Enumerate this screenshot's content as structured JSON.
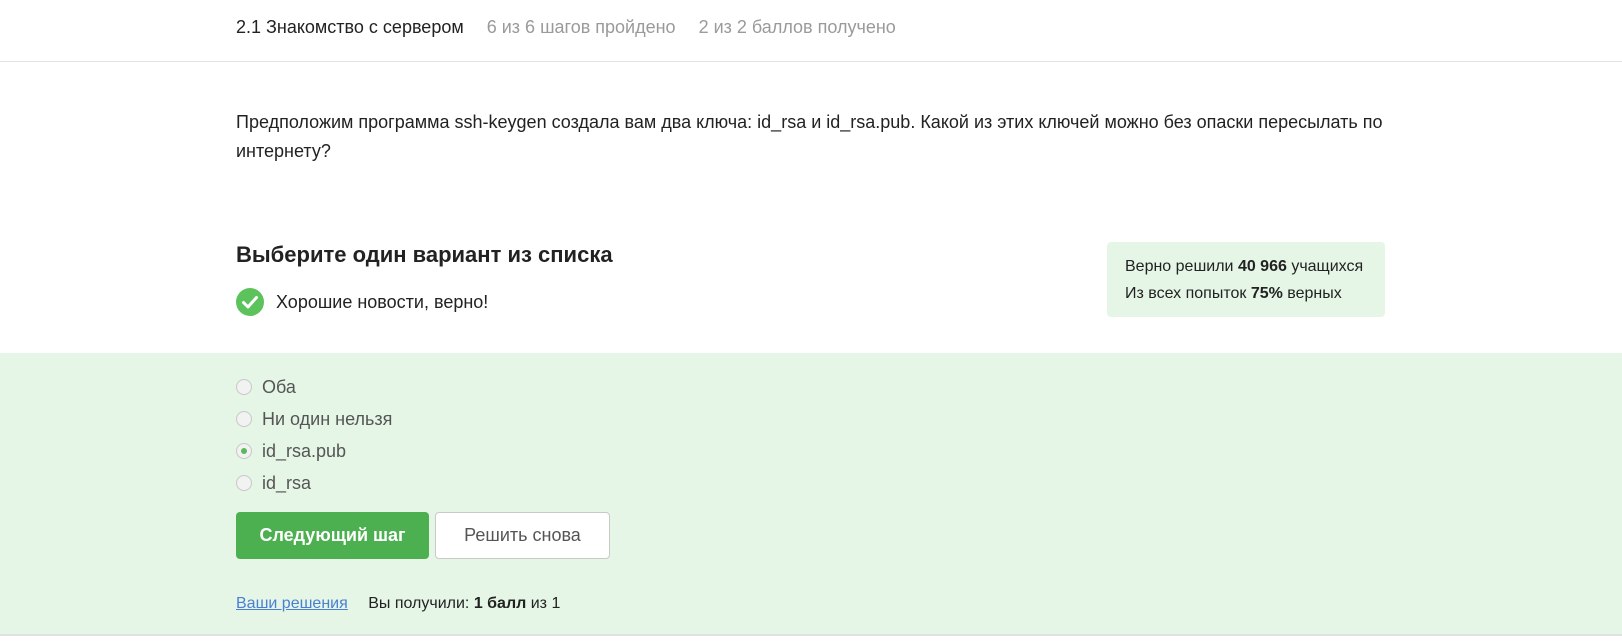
{
  "header": {
    "lesson_title": "2.1 Знакомство с сервером",
    "progress": "6 из 6 шагов пройдено",
    "score": "2 из 2 баллов  получено"
  },
  "question": {
    "text": "Предположим программа ssh-keygen создала вам два ключа: id_rsa и id_rsa.pub. Какой из этих ключей можно без опаски пересылать по интернету?"
  },
  "task": {
    "title": "Выберите один вариант из списка",
    "feedback": "Хорошие новости, верно!"
  },
  "stats": {
    "line1_prefix": "Верно решили ",
    "line1_value": "40 966",
    "line1_suffix": " учащихся",
    "line2_prefix": "Из всех попыток ",
    "line2_value": "75%",
    "line2_suffix": " верных"
  },
  "options": [
    {
      "label": "Оба",
      "checked": false
    },
    {
      "label": "Ни один нельзя",
      "checked": false
    },
    {
      "label": "id_rsa.pub",
      "checked": true
    },
    {
      "label": "id_rsa",
      "checked": false
    }
  ],
  "buttons": {
    "next": "Следующий шаг",
    "retry": "Решить снова"
  },
  "footer": {
    "solutions_link": "Ваши решения",
    "score_prefix": "Вы получили: ",
    "score_value": "1 балл",
    "score_suffix": " из 1"
  },
  "colors": {
    "accent_green": "#4caf50",
    "panel_bg": "#e6f6e6",
    "link_blue": "#4a7fd4"
  },
  "icons": {
    "feedback": "check-circle-icon"
  }
}
